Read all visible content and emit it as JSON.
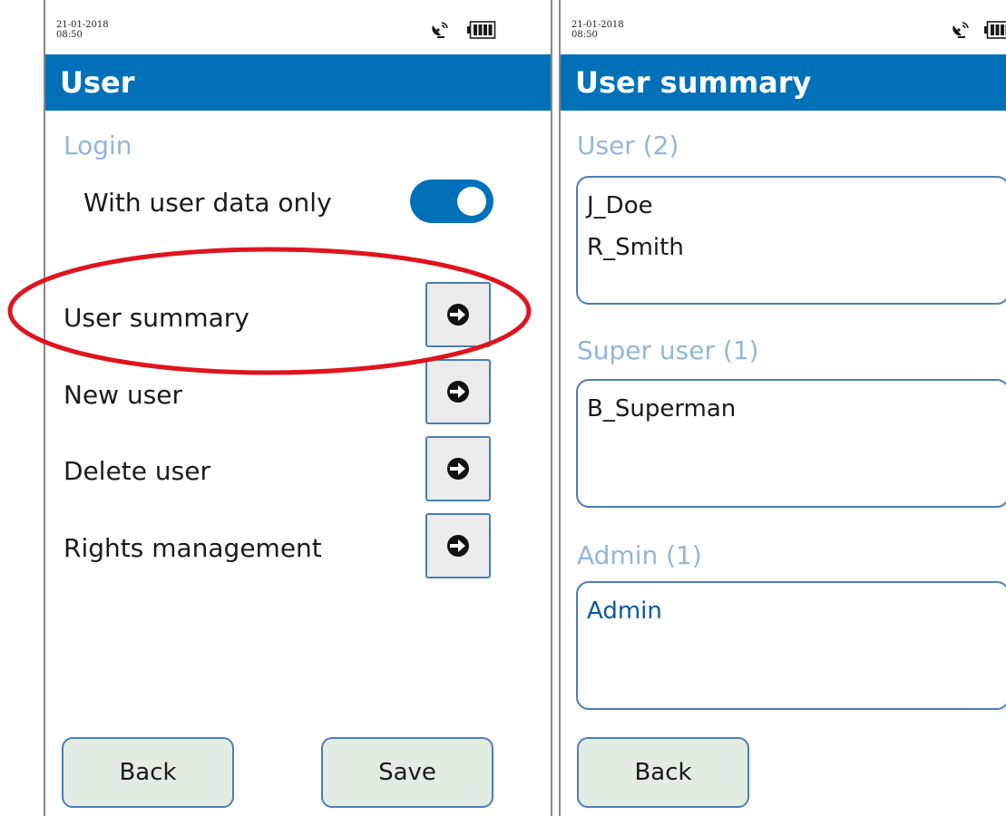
{
  "left_screen": {
    "status": {
      "date": "21-01-2018",
      "time": "08:50"
    },
    "title": "User",
    "login_section": "Login",
    "toggle": {
      "label": "With user data only",
      "state": "on"
    },
    "menu_items": [
      {
        "label": "User summary"
      },
      {
        "label": "New user"
      },
      {
        "label": "Delete user"
      },
      {
        "label": "Rights management"
      }
    ],
    "buttons": {
      "back": "Back",
      "save": "Save"
    },
    "annotation_color": "#e0141e"
  },
  "right_screen": {
    "status": {
      "date": "21-01-2018",
      "time": "08:50"
    },
    "title": "User summary",
    "sections": [
      {
        "heading": "User (2)",
        "items": [
          "J_Doe",
          "R_Smith"
        ]
      },
      {
        "heading": "Super user (1)",
        "items": [
          "B_Superman"
        ]
      },
      {
        "heading": "Admin (1)",
        "items": [
          "Admin"
        ]
      }
    ],
    "buttons": {
      "back": "Back"
    }
  },
  "theme": {
    "title_bar": "#0071b9",
    "section_label": "#93b6dc",
    "button_border": "#4a7fb8",
    "footer_button_bg": "#e3ece3"
  },
  "icons": [
    "satellite-icon",
    "battery-icon",
    "arrow-right-icon"
  ]
}
